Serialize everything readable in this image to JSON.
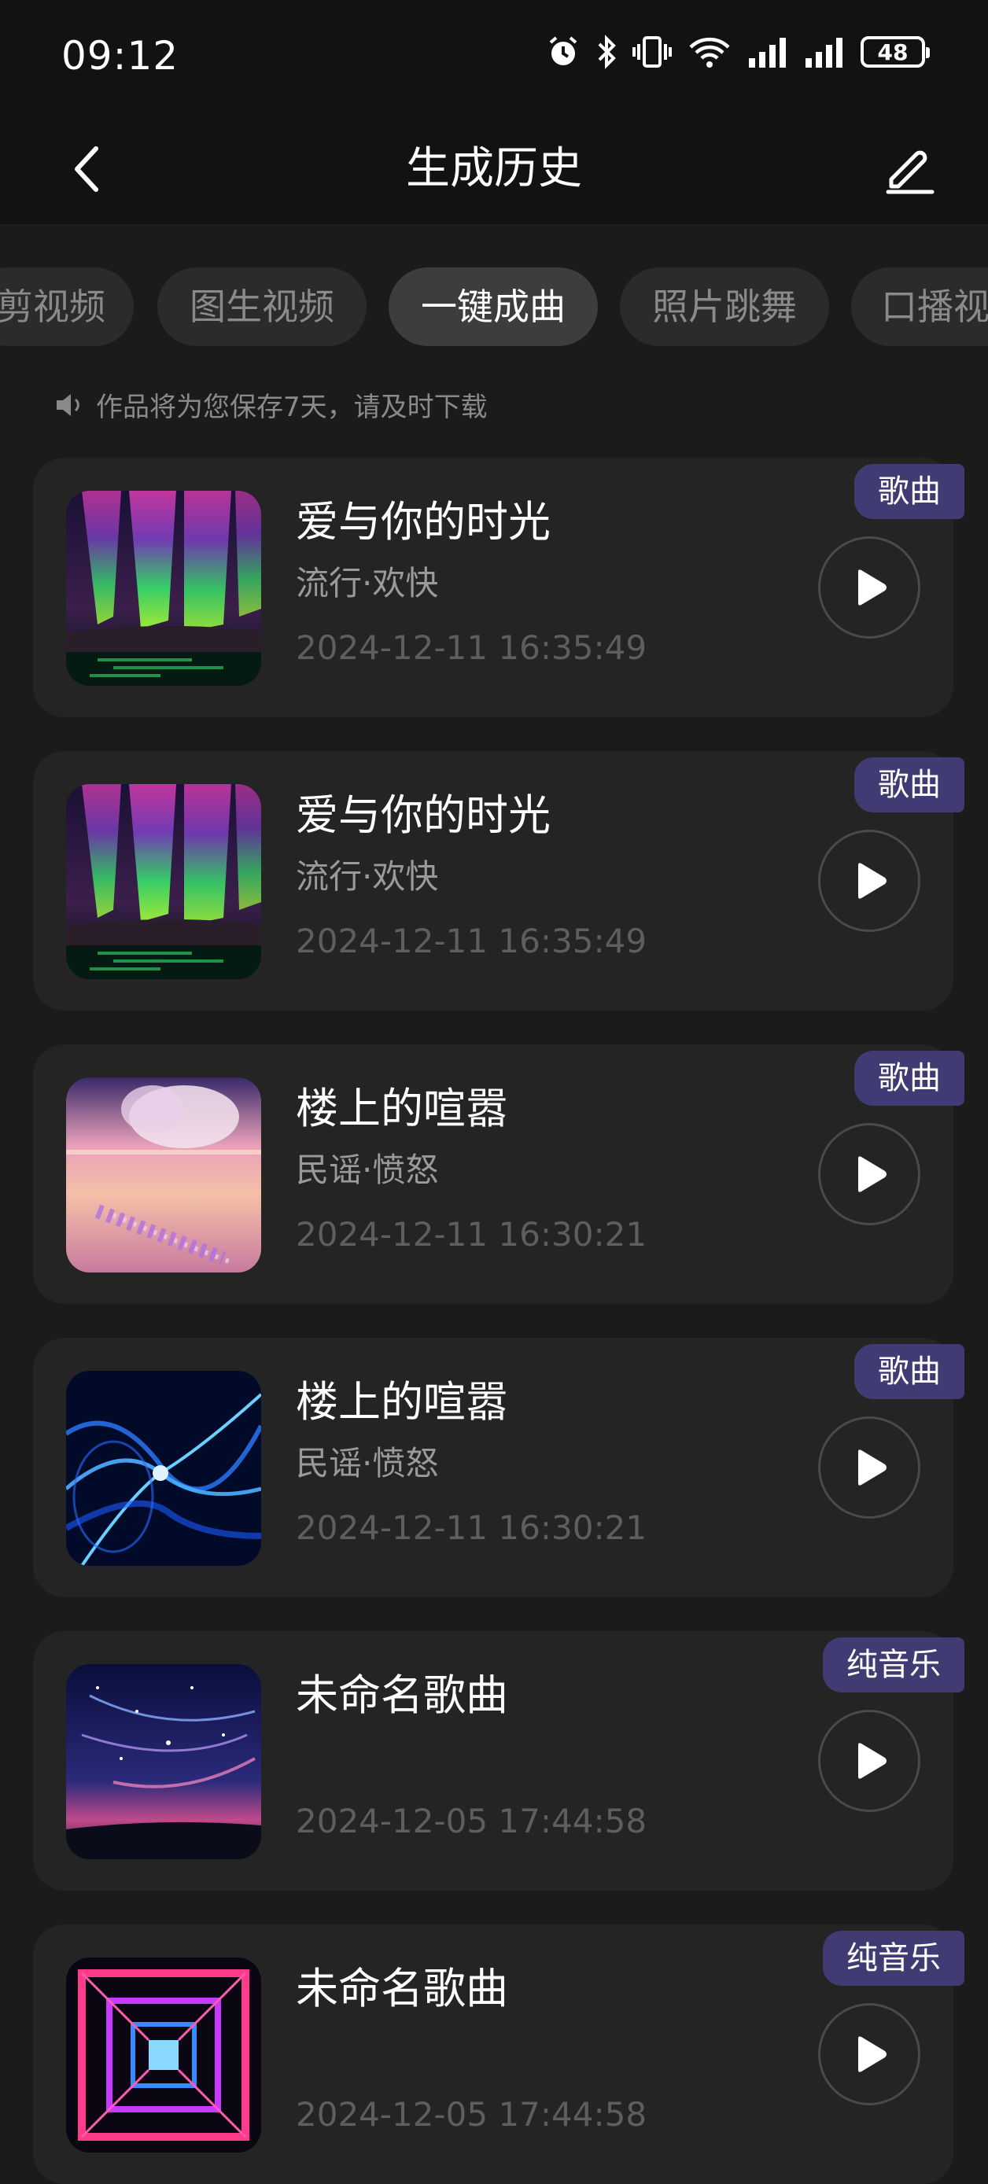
{
  "status_bar": {
    "time": "09:12",
    "battery": "48"
  },
  "nav": {
    "title": "生成历史"
  },
  "tabs": [
    "剪视频",
    "图生视频",
    "一键成曲",
    "照片跳舞",
    "口播视"
  ],
  "notice": "作品将为您保存7天，请及时下载",
  "items": [
    {
      "title": "爱与你的时光",
      "genre": "流行·欢快",
      "date": "2024-12-11 16:35:49",
      "badge": "歌曲",
      "thumb": "aurora"
    },
    {
      "title": "爱与你的时光",
      "genre": "流行·欢快",
      "date": "2024-12-11 16:35:49",
      "badge": "歌曲",
      "thumb": "aurora"
    },
    {
      "title": "楼上的喧嚣",
      "genre": "民谣·愤怒",
      "date": "2024-12-11 16:30:21",
      "badge": "歌曲",
      "thumb": "pink-beach"
    },
    {
      "title": "楼上的喧嚣",
      "genre": "民谣·愤怒",
      "date": "2024-12-11 16:30:21",
      "badge": "歌曲",
      "thumb": "blue-waves"
    },
    {
      "title": "未命名歌曲",
      "genre": "",
      "date": "2024-12-05 17:44:58",
      "badge": "纯音乐",
      "thumb": "starry-sky"
    },
    {
      "title": "未命名歌曲",
      "genre": "",
      "date": "2024-12-05 17:44:58",
      "badge": "纯音乐",
      "thumb": "neon-tunnel"
    }
  ],
  "colors": {
    "background": "#1b1b1b",
    "card": "#242424",
    "badge": "#413b73",
    "tab_active": "#3d3d3d"
  }
}
